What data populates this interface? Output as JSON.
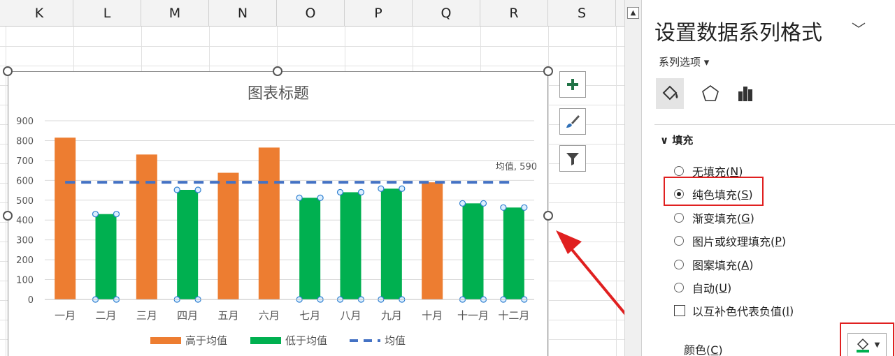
{
  "columns": [
    "K",
    "L",
    "M",
    "N",
    "O",
    "P",
    "Q",
    "R",
    "S"
  ],
  "chart_data": {
    "type": "bar",
    "title": "图表标题",
    "categories": [
      "一月",
      "二月",
      "三月",
      "四月",
      "五月",
      "六月",
      "七月",
      "八月",
      "九月",
      "十月",
      "十一月",
      "十二月"
    ],
    "series": [
      {
        "name": "高于均值",
        "color": "#ed7d31",
        "values": [
          815,
          null,
          730,
          null,
          638,
          765,
          null,
          null,
          null,
          590,
          null,
          null
        ]
      },
      {
        "name": "低于均值",
        "color": "#00b050",
        "values": [
          null,
          430,
          null,
          552,
          null,
          null,
          512,
          540,
          558,
          null,
          484,
          463
        ]
      },
      {
        "name": "均值",
        "type": "line",
        "color": "#4472c4",
        "value": 590
      }
    ],
    "ylim": [
      0,
      900
    ],
    "yticks": [
      0,
      100,
      200,
      300,
      400,
      500,
      600,
      700,
      800,
      900
    ],
    "avg_label": "均值, 590",
    "legend": "bottom"
  },
  "pane": {
    "title": "设置数据系列格式",
    "series_options": "系列选项 ▾",
    "section_fill": "填充",
    "options": [
      {
        "label": "无填充(",
        "key": "N",
        "checked": false
      },
      {
        "label": "纯色填充(",
        "key": "S",
        "checked": true
      },
      {
        "label": "渐变填充(",
        "key": "G",
        "checked": false
      },
      {
        "label": "图片或纹理填充(",
        "key": "P",
        "checked": false
      },
      {
        "label": "图案填充(",
        "key": "A",
        "checked": false
      },
      {
        "label": "自动(",
        "key": "U",
        "checked": false
      }
    ],
    "invert_label": "以互补色代表负值(",
    "invert_key": "I",
    "color_label": "颜色(",
    "color_key": "C"
  }
}
